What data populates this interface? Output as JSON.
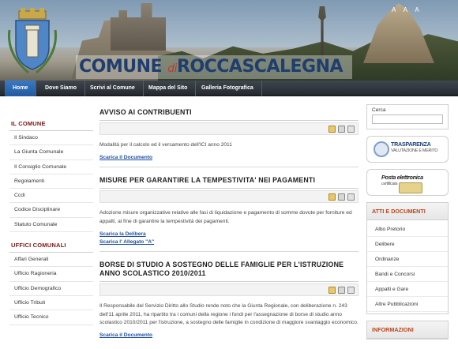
{
  "header": {
    "title_main": "COMUNE",
    "title_di": "di",
    "title_city": "ROCCASCALEGNA",
    "font_tools": "A A A"
  },
  "nav": {
    "items": [
      {
        "label": "Home",
        "active": true
      },
      {
        "label": "Dove Siamo",
        "active": false
      },
      {
        "label": "Scrivi al Comune",
        "active": false
      },
      {
        "label": "Mappa del Sito",
        "active": false
      },
      {
        "label": "Galleria Fotografica",
        "active": false
      }
    ]
  },
  "left": {
    "section1_title": "IL COMUNE",
    "section1_items": [
      "Il Sindaco",
      "La Giunta Comunale",
      "Il Consiglio Comunale",
      "Regolamenti",
      "Ccdi",
      "Codice Disciplinare",
      "Statuto Comunale"
    ],
    "section2_title": "UFFICI COMUNALI",
    "section2_items": [
      "Affari Generali",
      "Ufficio Ragioneria",
      "Ufficio Demografico",
      "Ufficio Tributi",
      "Ufficio Tecnico"
    ]
  },
  "articles": [
    {
      "title": "AVVISO AI CONTRIBUENTI",
      "body": "Modalità per il calcolo ed il versamento dell'ICI  anno 2011",
      "links": [
        "Scarica il Documento"
      ]
    },
    {
      "title": "MISURE PER GARANTIRE LA TEMPESTIVITA' NEI PAGAMENTI",
      "body": "Adozione misure organizzative relative alle fasi di liquidazione e pagamento di somme dovute per forniture ed appalti, al fine di garantire la tempestività dei pagamenti.",
      "links": [
        "Scarica la Delibera",
        "Scarica l' Allegato \"A\""
      ]
    },
    {
      "title": "BORSE DI STUDIO A SOSTEGNO DELLE FAMIGLIE PER L'ISTRUZIONE ANNO SCOLASTICO 2010/2011",
      "body": "Il Responsabile del Servizio Diritto allo Studio rende noto che la Giunta Regionale, con deliberazione n. 243 dell'11 aprile 2011, ha ripartito tra i comuni della regione i fondi per l'assegnazione di borse di studio anno scolastico 2010/2011 per l'istruzione, a sostegno delle famiglie in condizione di maggiore svantaggio economico.",
      "links": [
        "Scarica il Documento"
      ]
    }
  ],
  "right": {
    "search_label": "Cerca",
    "banner1_title": "TRASPARENZA",
    "banner1_sub": "VALUTAZIONE E MERITO",
    "banner2_title": "Posta elettronica",
    "banner2_sub": "certificata",
    "box1_title": "ATTI E DOCUMENTI",
    "box1_items": [
      "Albo Pretorio",
      "Delibere",
      "Ordinanze",
      "Bandi e Concorsi",
      "Appalti e Gare",
      "Altre Pubblicazioni"
    ],
    "box2_title": "INFORMAZIONI"
  }
}
